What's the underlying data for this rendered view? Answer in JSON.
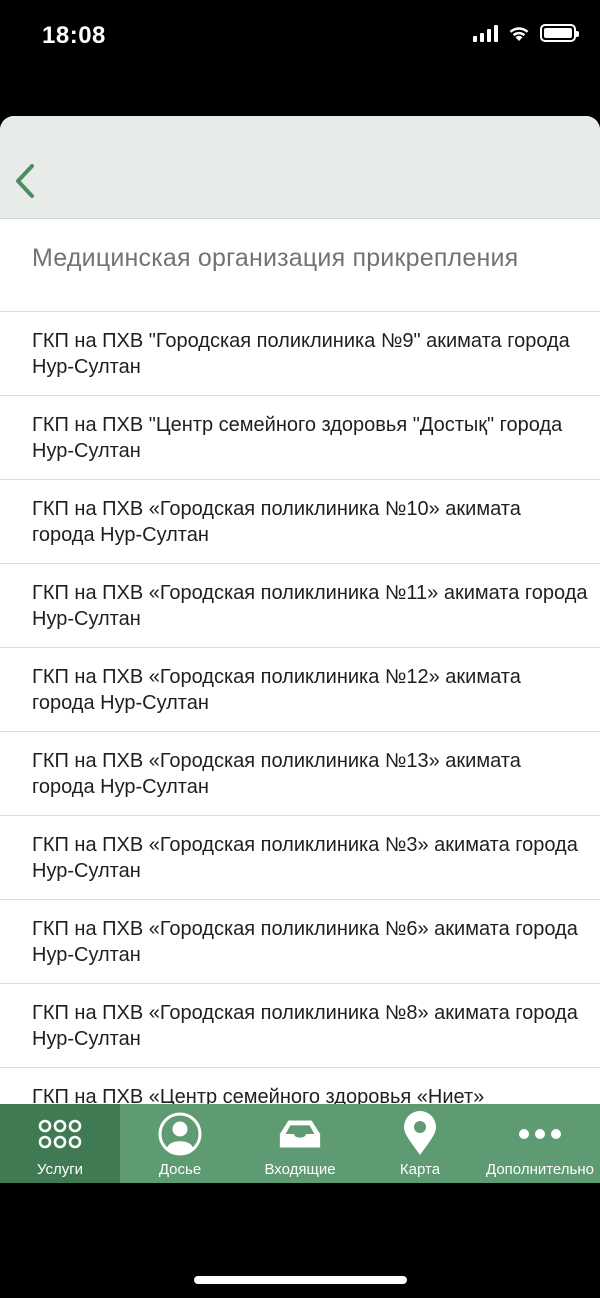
{
  "status_bar": {
    "time": "18:08"
  },
  "section": {
    "title": "Медицинская организация прикрепления"
  },
  "list": {
    "items": [
      "ГКП на ПХВ \"Городская поликлиника №9\" акимата города Нур-Султан",
      "ГКП на ПХВ \"Центр семейного здоровья \"Достық\" города Нур-Султан",
      "ГКП на ПХВ «Городская поликлиника №10» акимата города Нур-Султан",
      "ГКП на ПХВ «Городская поликлиника №11» акимата города Нур-Султан",
      "ГКП на ПХВ «Городская поликлиника №12» акимата города Нур-Султан",
      "ГКП на ПХВ «Городская поликлиника №13» акимата города Нур-Султан",
      "ГКП на ПХВ «Городская поликлиника №3» акимата города Нур-Султан",
      "ГКП на ПХВ «Городская поликлиника №6» акимата города Нур-Султан",
      "ГКП на ПХВ «Городская поликлиника №8» акимата города Нур-Султан",
      "ГКП на ПХВ «Центр семейного здоровья «Ниет»"
    ]
  },
  "tab_bar": {
    "tabs": [
      {
        "label": "Услуги",
        "icon": "grid-dots-icon",
        "active": true
      },
      {
        "label": "Досье",
        "icon": "person-icon",
        "active": false
      },
      {
        "label": "Входящие",
        "icon": "inbox-icon",
        "active": false
      },
      {
        "label": "Карта",
        "icon": "map-pin-icon",
        "active": false
      },
      {
        "label": "Дополнительно",
        "icon": "more-icon",
        "active": false
      }
    ]
  },
  "colors": {
    "accent": "#4e8c63",
    "tab_bar": "#5e9a72",
    "tab_active": "#3f7a52",
    "navbar": "#e8ece9"
  }
}
